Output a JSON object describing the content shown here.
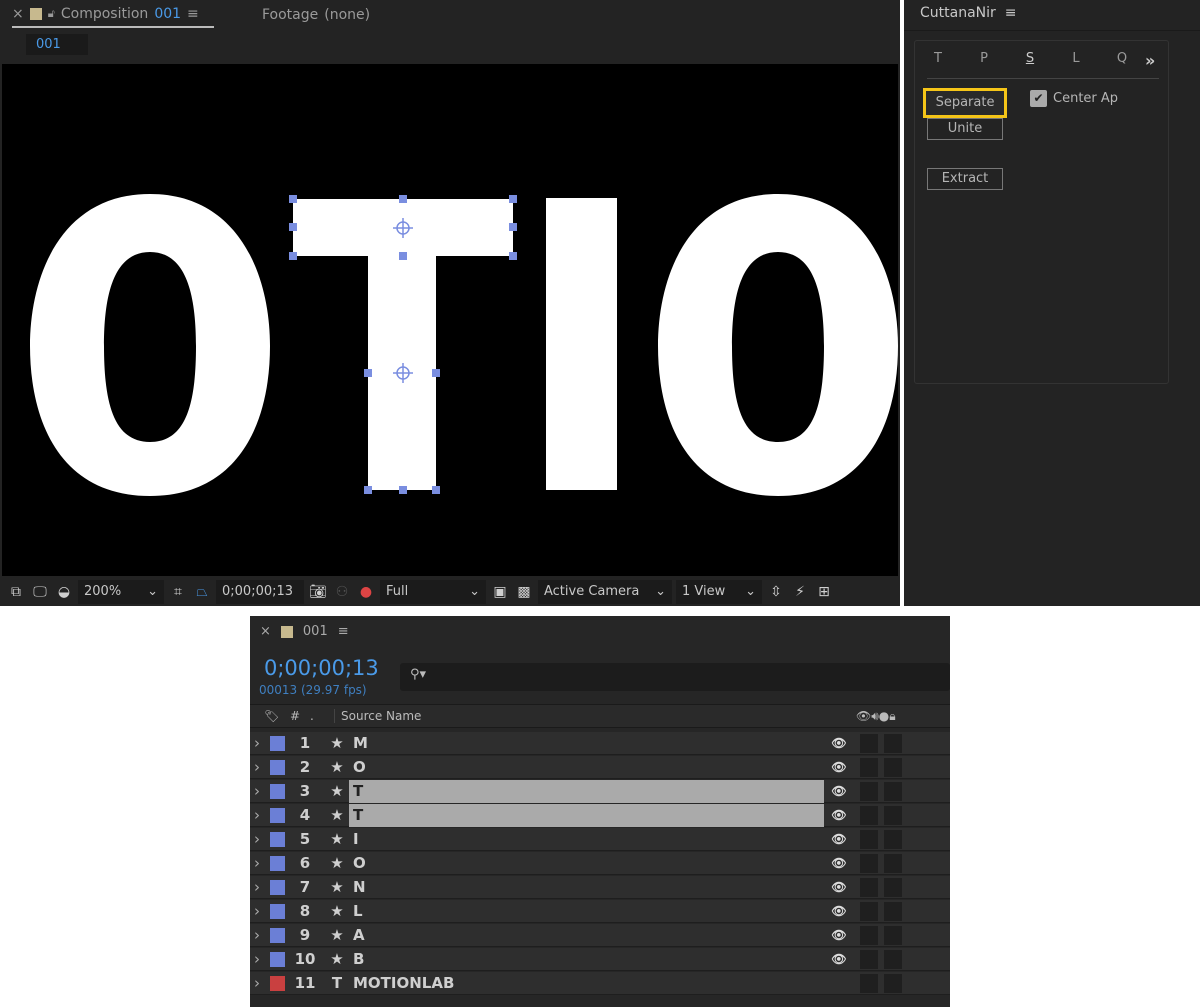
{
  "composition": {
    "close": "×",
    "lock_icon": "lock-icon",
    "tab_prefix": "Composition",
    "tab_name": "001",
    "menu": "≡",
    "footage_tab": "Footage",
    "footage_value": "(none)",
    "subtab": "001"
  },
  "viewer": {
    "letters": [
      "O",
      "T",
      "I",
      "O"
    ]
  },
  "viewer_bar": {
    "zoom": "200%",
    "timecode": "0;00;00;13",
    "resolution": "Full",
    "camera": "Active Camera",
    "views": "1 View"
  },
  "panel": {
    "title": "CuttanaNir",
    "menu": "≡",
    "tabs": [
      "T",
      "P",
      "S",
      "L",
      "Q"
    ],
    "active_tab": "S",
    "more": "»",
    "separate": "Separate",
    "unite": "Unite",
    "extract": "Extract",
    "center_ap": "Center Ap",
    "center_ap_checked": true,
    "highlight_color": "#f5c518"
  },
  "timeline": {
    "close": "×",
    "name": "001",
    "menu": "≡",
    "timecode": "0;00;00;13",
    "frames": "00013 (29.97 fps)",
    "search_placeholder": "",
    "col_num": "#",
    "col_dot": ".",
    "col_source": "Source Name",
    "layers": [
      {
        "n": "1",
        "type": "★",
        "name": "M",
        "color": "#6b7fd6",
        "selected": false,
        "eye": true
      },
      {
        "n": "2",
        "type": "★",
        "name": "O",
        "color": "#6b7fd6",
        "selected": false,
        "eye": true
      },
      {
        "n": "3",
        "type": "★",
        "name": "T",
        "color": "#6b7fd6",
        "selected": true,
        "eye": true
      },
      {
        "n": "4",
        "type": "★",
        "name": "T",
        "color": "#6b7fd6",
        "selected": true,
        "eye": true
      },
      {
        "n": "5",
        "type": "★",
        "name": "I",
        "color": "#6b7fd6",
        "selected": false,
        "eye": true
      },
      {
        "n": "6",
        "type": "★",
        "name": "O",
        "color": "#6b7fd6",
        "selected": false,
        "eye": true
      },
      {
        "n": "7",
        "type": "★",
        "name": "N",
        "color": "#6b7fd6",
        "selected": false,
        "eye": true
      },
      {
        "n": "8",
        "type": "★",
        "name": "L",
        "color": "#6b7fd6",
        "selected": false,
        "eye": true
      },
      {
        "n": "9",
        "type": "★",
        "name": "A",
        "color": "#6b7fd6",
        "selected": false,
        "eye": true
      },
      {
        "n": "10",
        "type": "★",
        "name": "B",
        "color": "#6b7fd6",
        "selected": false,
        "eye": true
      },
      {
        "n": "11",
        "type": "T",
        "name": "MOTIONLAB",
        "color": "#c94040",
        "selected": false,
        "eye": false
      }
    ]
  }
}
